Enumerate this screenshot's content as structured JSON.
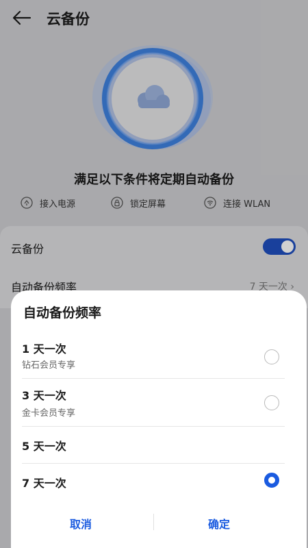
{
  "header": {
    "title": "云备份",
    "back_icon": "back-arrow-icon"
  },
  "conditions": {
    "title": "满足以下条件将定期自动备份",
    "items": [
      {
        "label": "接入电源",
        "icon": "power-plug-icon"
      },
      {
        "label": "锁定屏幕",
        "icon": "lock-icon"
      },
      {
        "label": "连接 WLAN",
        "icon": "wifi-icon"
      }
    ]
  },
  "settings": {
    "cloud_backup_label": "云备份",
    "cloud_backup_enabled": true,
    "frequency_label": "自动备份频率",
    "frequency_value": "7 天一次"
  },
  "dialog": {
    "title": "自动备份频率",
    "options": [
      {
        "label": "1 天一次",
        "sub": "钻石会员专享",
        "selected": false
      },
      {
        "label": "3 天一次",
        "sub": "金卡会员专享",
        "selected": false
      },
      {
        "label": "5 天一次",
        "sub": "",
        "selected": false
      },
      {
        "label": "7 天一次",
        "sub": "",
        "selected": true
      }
    ],
    "cancel_label": "取消",
    "confirm_label": "确定"
  },
  "colors": {
    "accent": "#1a5be0",
    "toggle_on": "#1f4fbf"
  }
}
